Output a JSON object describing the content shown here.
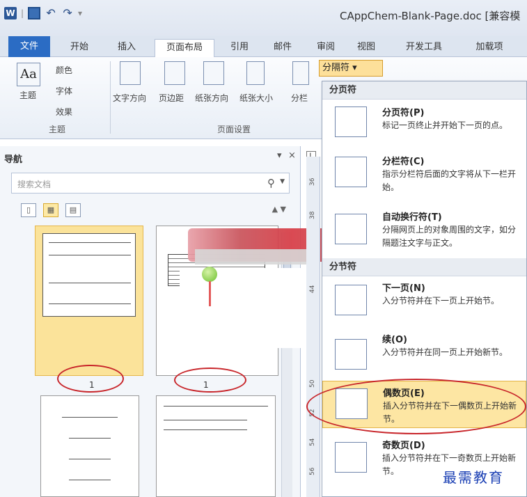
{
  "window": {
    "title": "CAppChem-Blank-Page.doc [兼容模"
  },
  "qat": {
    "word": "W",
    "sep": "|"
  },
  "tabs": [
    "文件",
    "开始",
    "插入",
    "页面布局",
    "引用",
    "邮件",
    "审阅",
    "视图",
    "开发工具",
    "加载项"
  ],
  "ribbon": {
    "theme_group": {
      "caption": "主题",
      "big": "主题",
      "colors": "颜色",
      "fonts": "字体",
      "effects": "效果"
    },
    "page_setup": {
      "caption": "页面设置",
      "text_dir": "文字方向",
      "margins": "页边距",
      "orientation": "纸张方向",
      "size": "纸张大小",
      "columns": "分栏"
    },
    "breaks_button": "分隔符"
  },
  "nav": {
    "title": "导航",
    "search_placeholder": "搜索文档",
    "page_labels": [
      "1",
      "1"
    ]
  },
  "ruler": {
    "ticks": [
      "36",
      "38",
      "44",
      "50",
      "52",
      "54",
      "56"
    ],
    "corner": "L"
  },
  "menu": {
    "section1": "分页符",
    "section2": "分节符",
    "items": [
      {
        "name": "分页符(P)",
        "desc": "标记一页终止并开始下一页的点。"
      },
      {
        "name": "分栏符(C)",
        "desc": "指示分栏符后面的文字将从下一栏开始。"
      },
      {
        "name": "自动换行符(T)",
        "desc": "分隔网页上的对象周围的文字，如分隔题注文字与正文。"
      },
      {
        "name": "下一页(N)",
        "desc": "入分节符并在下一页上开始节。"
      },
      {
        "name": "续(O)",
        "desc": "入分节符并在同一页上开始新节。"
      },
      {
        "name": "偶数页(E)",
        "desc": "插入分节符并在下一偶数页上开始新节。"
      },
      {
        "name": "奇数页(D)",
        "desc": "插入分节符并在下一奇数页上开始新节。"
      }
    ]
  },
  "watermark": "最需教育",
  "colors": {
    "file_tab": "#2b6cc4",
    "highlight": "#fde6a3",
    "annotation_red": "#c8252a",
    "watermark": "#1a3fb4"
  },
  "icons": [
    "word-icon",
    "save-icon",
    "undo-icon",
    "redo-icon",
    "search-icon",
    "close-icon",
    "dropdown-arrow-icon"
  ]
}
